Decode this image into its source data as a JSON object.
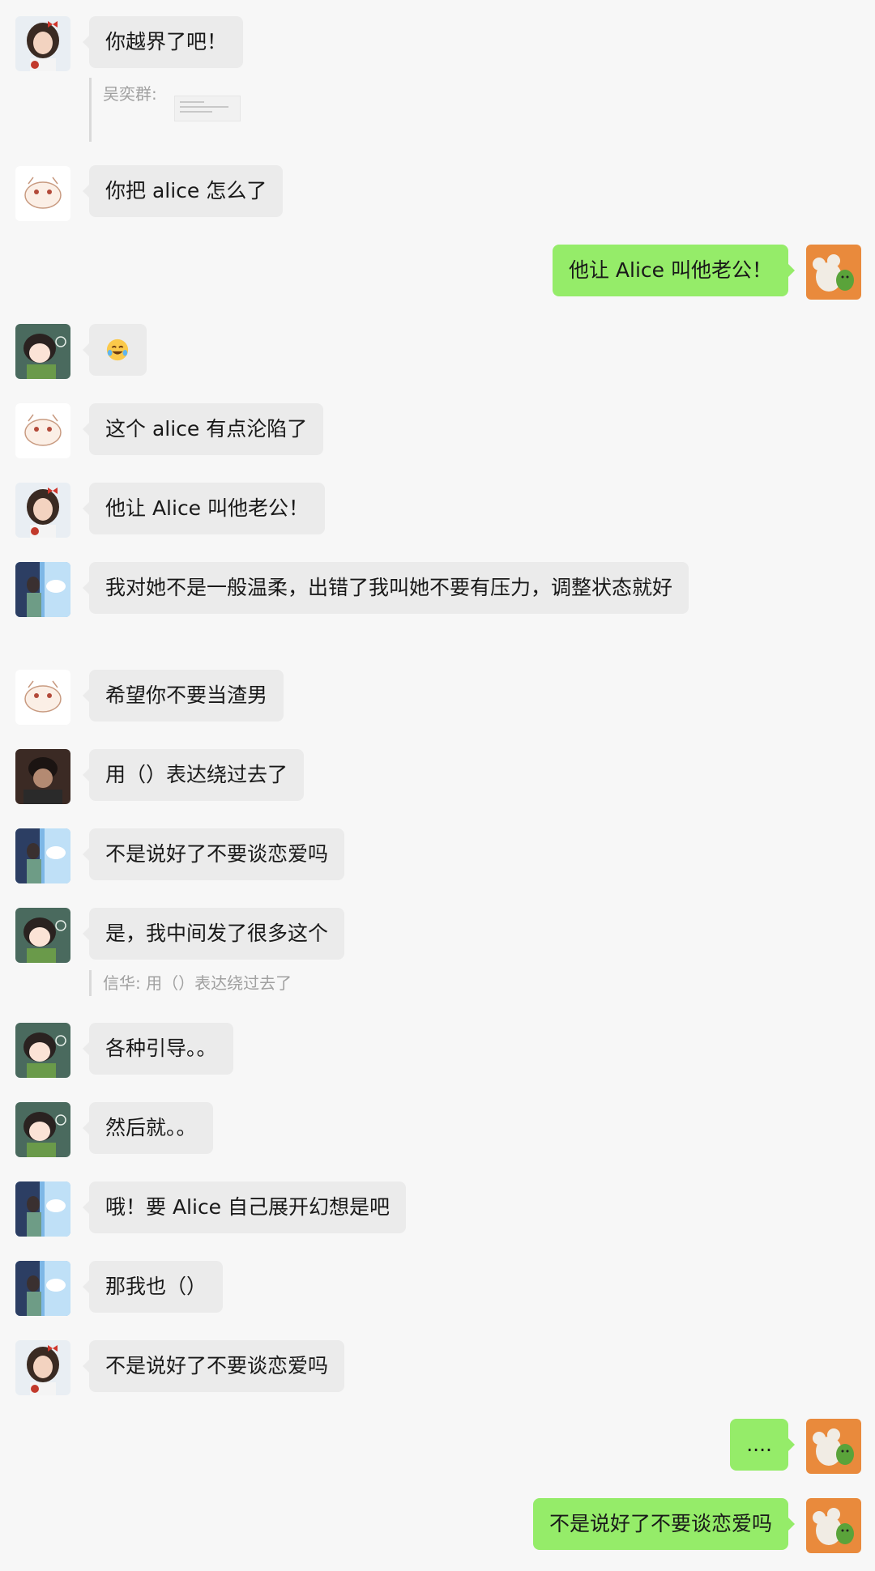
{
  "messages": [
    {
      "text": "你越界了吧！"
    },
    {
      "text": "你把 alice 怎么了"
    },
    {
      "text": "他让 Alice 叫他老公！"
    },
    {
      "text": "",
      "emoji": "laughing-crying-emoji"
    },
    {
      "text": "这个 alice 有点沦陷了"
    },
    {
      "text": "他让 Alice 叫他老公！"
    },
    {
      "text": "我对她不是一般温柔，出错了我叫她不要有压力，调整状态就好"
    },
    {
      "text": "希望你不要当渣男"
    },
    {
      "text": "用（）表达绕过去了"
    },
    {
      "text": "不是说好了不要谈恋爱吗"
    },
    {
      "text": "是，我中间发了很多这个"
    },
    {
      "text": "各种引导。。"
    },
    {
      "text": "然后就。。"
    },
    {
      "text": "哦！要 Alice 自己展开幻想是吧"
    },
    {
      "text": "那我也（）"
    },
    {
      "text": "不是说好了不要谈恋爱吗"
    },
    {
      "text": "...."
    },
    {
      "text": "不是说好了不要谈恋爱吗"
    }
  ],
  "quotes": [
    {
      "text": "吴奕群:"
    },
    {
      "text": "信华: 用（）表达绕过去了"
    }
  ],
  "colors": {
    "incoming_bubble": "#ebebeb",
    "outgoing_bubble": "#95ec69",
    "background": "#f7f7f7"
  }
}
